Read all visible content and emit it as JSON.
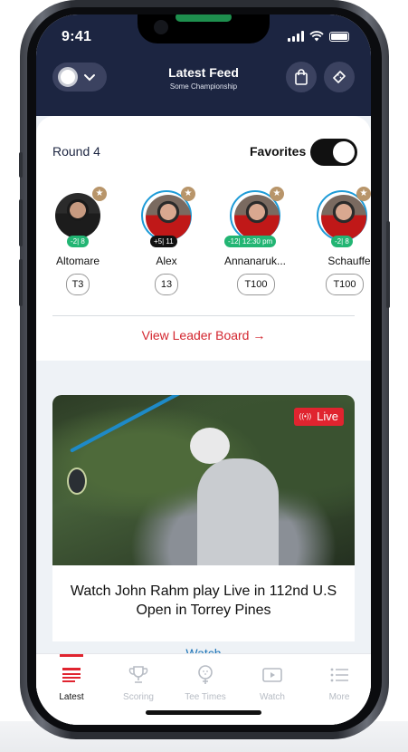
{
  "status": {
    "time": "9:41"
  },
  "header": {
    "title": "Latest Feed",
    "subtitle": "Some Championship"
  },
  "leaderboard": {
    "round_label": "Round 4",
    "favorites_label": "Favorites",
    "favorites_on": true,
    "players": [
      {
        "name": "Altomare",
        "score": "-2| 8",
        "position": "T3",
        "chip": "green"
      },
      {
        "name": "Alex",
        "score": "+5| 11",
        "position": "13",
        "chip": "black"
      },
      {
        "name": "Annanaruk...",
        "score": "-12| 12:30 pm",
        "position": "T100",
        "chip": "green"
      },
      {
        "name": "Schauffe",
        "score": "-2| 8",
        "position": "T100",
        "chip": "green"
      }
    ],
    "view_link": "View Leader Board  →"
  },
  "feed": {
    "badge": "Live",
    "title": "Watch John Rahm play Live in 112nd U.S Open in Torrey Pines",
    "action": "Watch"
  },
  "tabs": [
    {
      "label": "Latest",
      "icon": "news-icon"
    },
    {
      "label": "Scoring",
      "icon": "trophy-icon"
    },
    {
      "label": "Tee Times",
      "icon": "golf-ball-icon"
    },
    {
      "label": "Watch",
      "icon": "play-icon"
    },
    {
      "label": "More",
      "icon": "list-icon"
    }
  ],
  "colors": {
    "header_bg": "#1c2541",
    "accent_red": "#e0242f",
    "link_blue": "#1e75b8",
    "green": "#22b573"
  }
}
